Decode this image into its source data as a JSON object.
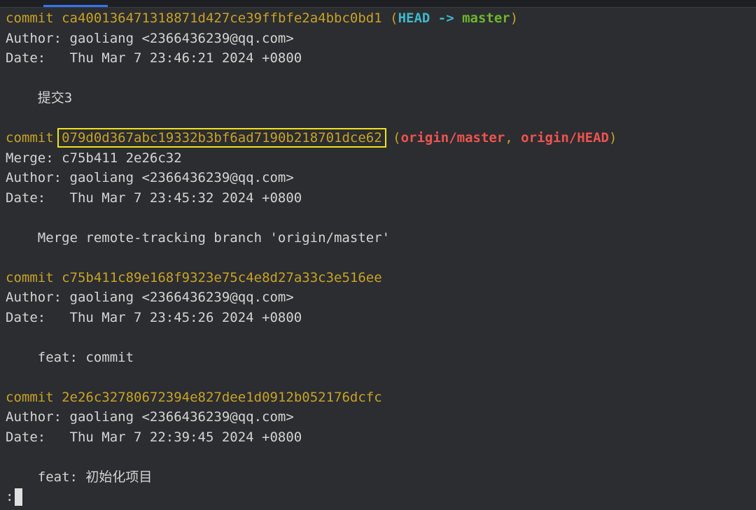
{
  "commits": [
    {
      "keyword": "commit",
      "hash": "ca400136471318871d427ce39ffbfe2a4bbc0bd1",
      "refs_open": "(",
      "ref_head": "HEAD",
      "ref_arrow": " -> ",
      "ref_branch": "master",
      "refs_close": ")",
      "author_line": "Author: gaoliang <2366436239@qq.com>",
      "date_line": "Date:   Thu Mar 7 23:46:21 2024 +0800",
      "message": "    提交3"
    },
    {
      "keyword": "commit",
      "hash": "079d0d367abc19332b3bf6ad7190b218701dce62",
      "refs_open": "(",
      "ref_origin_master": "origin/master",
      "ref_sep": ", ",
      "ref_origin_head": "origin/HEAD",
      "refs_close": ")",
      "merge_line": "Merge: c75b411 2e26c32",
      "author_line": "Author: gaoliang <2366436239@qq.com>",
      "date_line": "Date:   Thu Mar 7 23:45:32 2024 +0800",
      "message": "    Merge remote-tracking branch 'origin/master'"
    },
    {
      "keyword": "commit",
      "hash": "c75b411c89e168f9323e75c4e8d27a33c3e516ee",
      "author_line": "Author: gaoliang <2366436239@qq.com>",
      "date_line": "Date:   Thu Mar 7 23:45:26 2024 +0800",
      "message": "    feat: commit"
    },
    {
      "keyword": "commit",
      "hash": "2e26c32780672394e827dee1d0912b052176dcfc",
      "author_line": "Author: gaoliang <2366436239@qq.com>",
      "date_line": "Date:   Thu Mar 7 22:39:45 2024 +0800",
      "message": "    feat: 初始化项目"
    }
  ],
  "prompt": ":",
  "colors": {
    "background": "#2b2d30",
    "hash": "#c9a227",
    "head": "#3fb8c9",
    "branch": "#6fb52c",
    "remote": "#ef5350",
    "highlight_box": "#f2e21c"
  }
}
